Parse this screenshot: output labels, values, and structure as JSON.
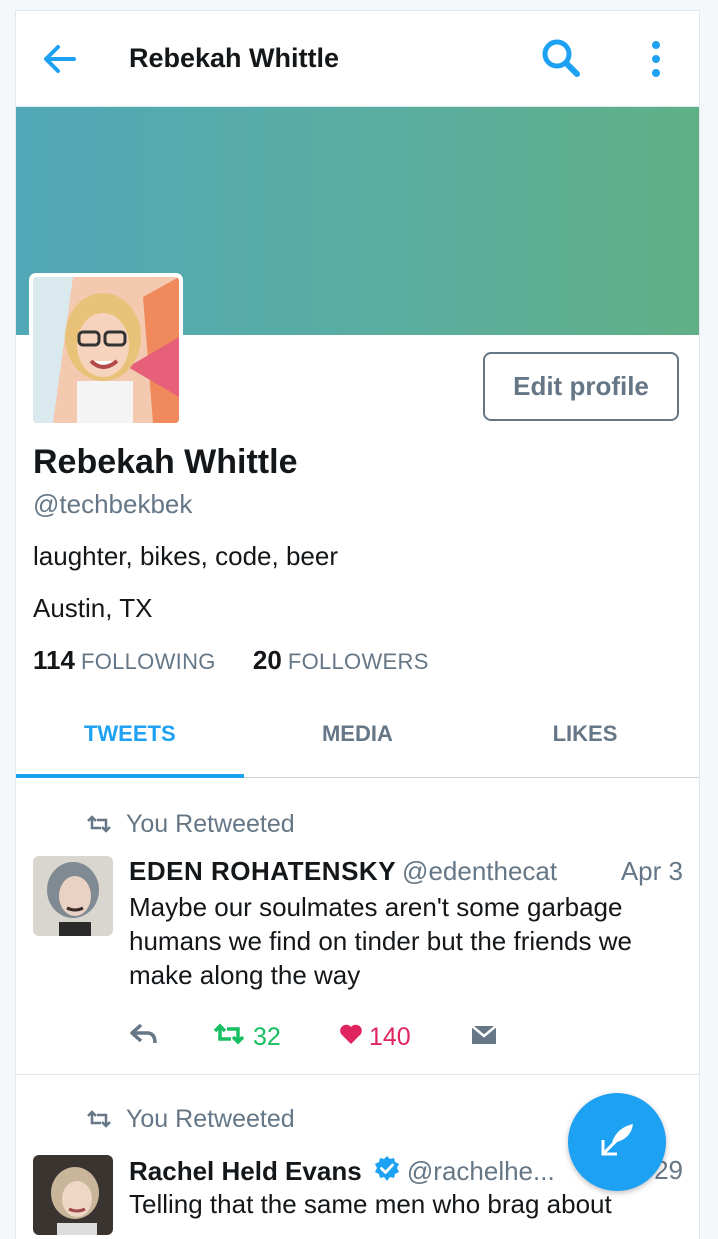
{
  "header": {
    "title": "Rebekah Whittle"
  },
  "profile": {
    "edit_label": "Edit profile",
    "name": "Rebekah Whittle",
    "handle": "@techbekbek",
    "bio": "laughter, bikes, code, beer",
    "location": "Austin, TX",
    "following_count": "114",
    "following_label": "FOLLOWING",
    "followers_count": "20",
    "followers_label": "FOLLOWERS"
  },
  "tabs": [
    {
      "label": "TWEETS",
      "active": true
    },
    {
      "label": "MEDIA",
      "active": false
    },
    {
      "label": "LIKES",
      "active": false
    }
  ],
  "tweets": [
    {
      "context": "You Retweeted",
      "name": "EDEN ROHATENSKY",
      "handle": "@edenthecat",
      "date": "Apr 3",
      "text": "Maybe our soulmates aren't some garbage humans we find on tinder but the friends we make along the way",
      "retweets": "32",
      "likes": "140"
    },
    {
      "context": "You Retweeted",
      "name": "Rachel Held Evans",
      "verified": true,
      "handle": "@rachelhe...",
      "date": "29",
      "text": "Telling that the same men who brag about"
    }
  ],
  "colors": {
    "accent": "#1da1f2",
    "retweet": "#17bf63",
    "like": "#e0245e",
    "muted": "#657786"
  }
}
